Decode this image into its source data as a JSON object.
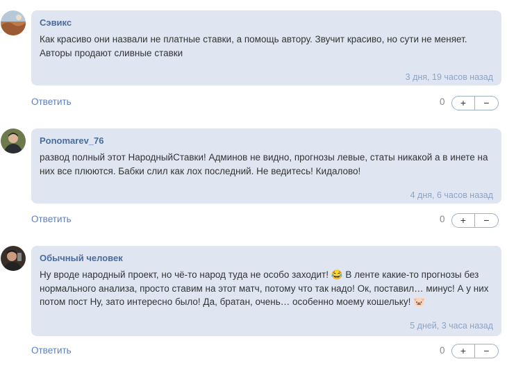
{
  "comments": [
    {
      "author": "Сэвикс",
      "text": "Как красиво они назвали не платные ставки, а помощь автору. Звучит красиво, но сути не меняет. Авторы продают сливные ставки",
      "time": "3 дня, 19 часов назад",
      "reply_label": "Ответить",
      "votes": "0",
      "plus_label": "+",
      "minus_label": "−"
    },
    {
      "author": "Ponomarev_76",
      "text": "развод полный этот НародныйСтавки! Админов не видно, прогнозы левые, статы никакой а в инете на них все плюются. Бабки слил как лох последний. Не ведитесь! Кидалово!",
      "time": "4 дня, 6 часов назад",
      "reply_label": "Ответить",
      "votes": "0",
      "plus_label": "+",
      "minus_label": "−"
    },
    {
      "author": "Обычный человек",
      "text_part1": "Ну вроде народный проект, но чё-то народ туда не особо заходит!",
      "text_part2": "В ленте какие-то прогнозы без нормального анализа, просто ставим на этот матч, потому что так надо! Ок, поставил… минус! А у них потом пост Ну, зато интересно было! Да, братан, очень… особенно моему кошельку!",
      "time": "5 дней, 3 часа назад",
      "reply_label": "Ответить",
      "votes": "0",
      "plus_label": "+",
      "minus_label": "−"
    }
  ],
  "icons": {
    "laugh_emoji": "😂",
    "pig_emoji": "🐷"
  },
  "colors": {
    "bubble": "#dfe6f1",
    "author": "#4a6b9c",
    "link": "#5a7fbf",
    "time": "#8fa3c4"
  }
}
